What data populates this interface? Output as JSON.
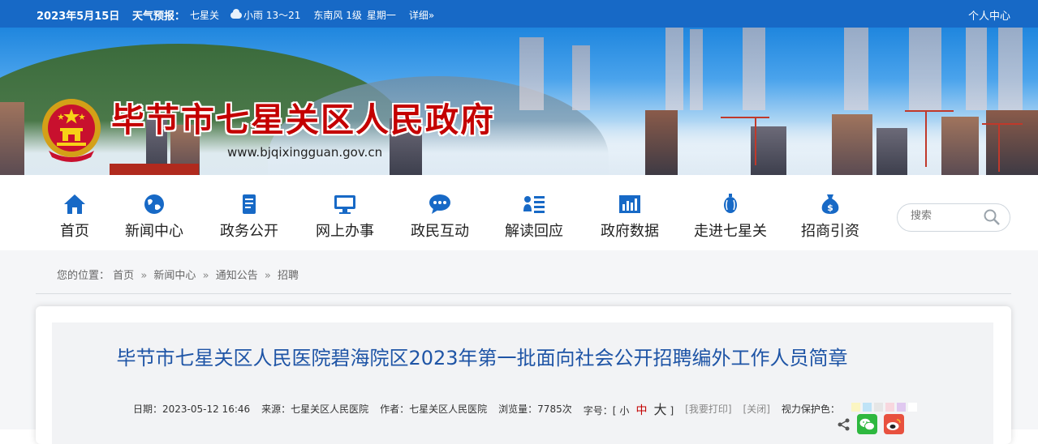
{
  "topbar": {
    "date": "2023年5月15日",
    "weather_label": "天气预报：",
    "city": "七星关",
    "weather": "小雨 13～21",
    "wind": "东南风 1级",
    "weekday": "星期一",
    "detail": "详细»",
    "user_center": "个人中心"
  },
  "header": {
    "title": "毕节市七星关区人民政府",
    "url": "www.bjqixingguan.gov.cn"
  },
  "nav": {
    "items": [
      {
        "label": "首页",
        "icon": "home-icon"
      },
      {
        "label": "新闻中心",
        "icon": "globe-icon"
      },
      {
        "label": "政务公开",
        "icon": "document-icon"
      },
      {
        "label": "网上办事",
        "icon": "monitor-icon"
      },
      {
        "label": "政民互动",
        "icon": "chat-icon"
      },
      {
        "label": "解读回应",
        "icon": "list-icon"
      },
      {
        "label": "政府数据",
        "icon": "bar-chart-icon"
      },
      {
        "label": "走进七星关",
        "icon": "lantern-icon"
      },
      {
        "label": "招商引资",
        "icon": "money-bag-icon"
      }
    ],
    "search_placeholder": "搜索"
  },
  "breadcrumb": {
    "prefix": "您的位置：",
    "items": [
      "首页",
      "新闻中心",
      "通知公告",
      "招聘"
    ],
    "separator": "»"
  },
  "article": {
    "title": "毕节市七星关区人民医院碧海院区2023年第一批面向社会公开招聘编外工作人员简章",
    "date": "日期：2023-05-12 16:46",
    "source": "来源：七星关区人民医院",
    "author": "作者：七星关区人民医院",
    "views": "浏览量：7785次",
    "font_size_label": "字号：",
    "font_small": "小",
    "font_medium": "中",
    "font_large": "大",
    "bracket_open": "[",
    "bracket_close": "]",
    "print": "[我要打印]",
    "close": "[关闭]",
    "eye_protect_label": "视力保护色：",
    "eye_colors": [
      "#fbf5c2",
      "#bfe3f7",
      "#e6e6e6",
      "#f8d7de",
      "#e0c8f0",
      "#ffffff"
    ]
  },
  "colors": {
    "accent": "#1769c6",
    "title_red": "#c40000",
    "article_title": "#1f55a6",
    "wechat": "#2eb83f",
    "weibo": "#e8513f"
  }
}
